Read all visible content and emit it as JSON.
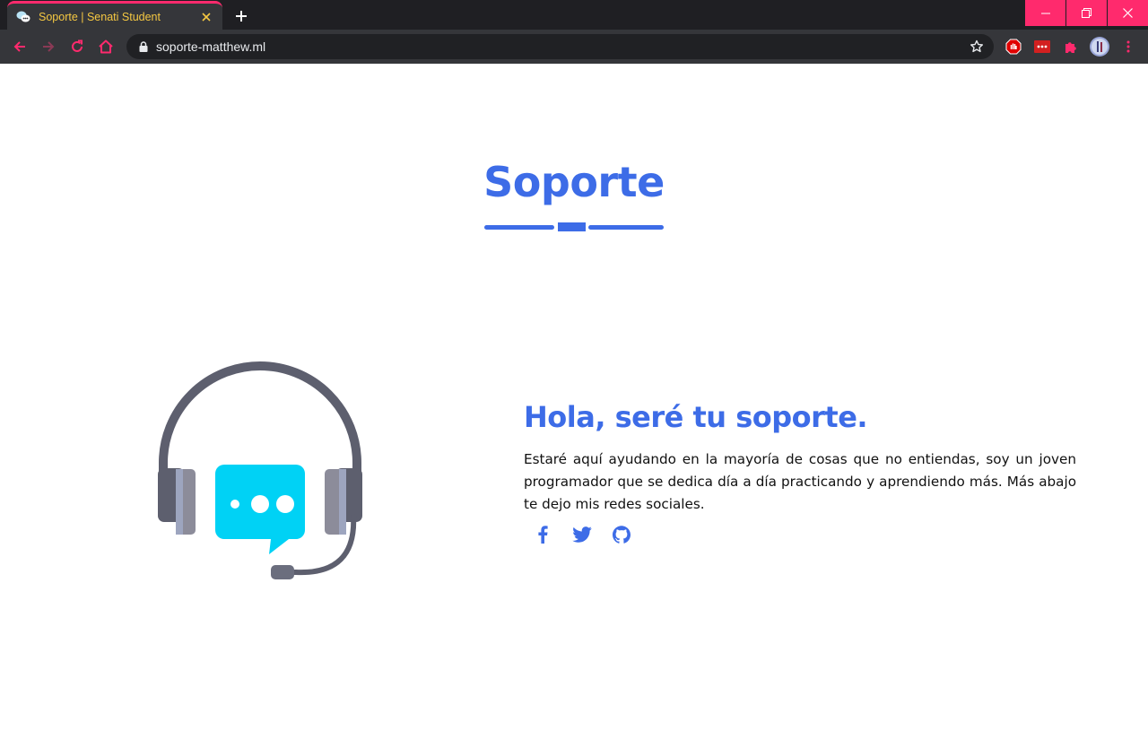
{
  "browser": {
    "tab": {
      "title": "Soporte | Senati Student"
    },
    "address_bar": {
      "url": "soporte-matthew.ml"
    }
  },
  "page": {
    "section_title": "Soporte",
    "headline": "Hola, seré tu soporte.",
    "description": "Estaré aquí ayudando en la mayoría de cosas que no entiendas, soy un joven programador que se dedica día a día practicando y aprendiendo más. Más abajo te dejo mis redes sociales.",
    "socials": [
      "facebook-icon",
      "twitter-icon",
      "github-icon"
    ]
  },
  "colors": {
    "accent": "#3d6ce7",
    "browser_accent": "#ff2a6d",
    "chat_bubble": "#00d2f5",
    "headset": "#5d5f6e"
  }
}
